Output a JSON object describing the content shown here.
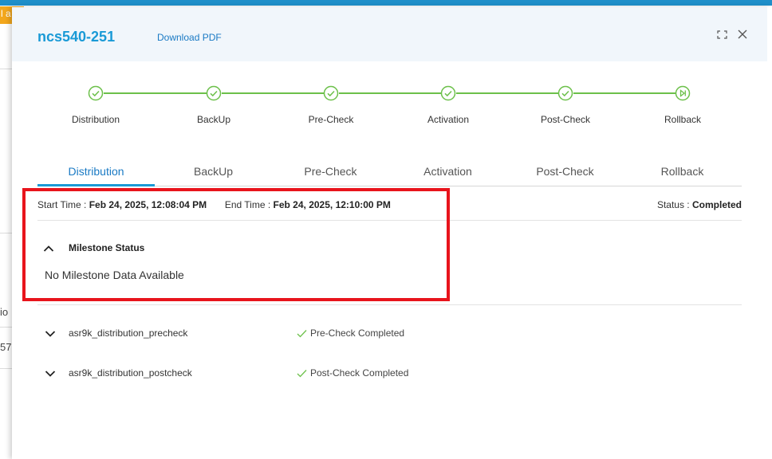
{
  "background": {
    "banner_text": "l a",
    "side_text_1": "io",
    "side_text_2": "57."
  },
  "header": {
    "title": "ncs540-251",
    "download_link": "Download PDF"
  },
  "stepper": {
    "steps": [
      {
        "label": "Distribution",
        "state": "complete",
        "icon": "check-circle-icon"
      },
      {
        "label": "BackUp",
        "state": "complete",
        "icon": "check-circle-icon"
      },
      {
        "label": "Pre-Check",
        "state": "complete",
        "icon": "check-circle-icon"
      },
      {
        "label": "Activation",
        "state": "complete",
        "icon": "check-circle-icon"
      },
      {
        "label": "Post-Check",
        "state": "complete",
        "icon": "check-circle-icon"
      },
      {
        "label": "Rollback",
        "state": "current",
        "icon": "skip-forward-circle-icon"
      }
    ],
    "accent_color": "#6cc04a"
  },
  "tabs": {
    "items": [
      "Distribution",
      "BackUp",
      "Pre-Check",
      "Activation",
      "Post-Check",
      "Rollback"
    ],
    "active": "Distribution",
    "accent_color": "#1a9ad6"
  },
  "details": {
    "start_time_label": "Start Time :",
    "start_time_value": "Feb 24, 2025, 12:08:04 PM",
    "end_time_label": "End Time :",
    "end_time_value": "Feb 24, 2025, 12:10:00 PM",
    "status_label": "Status :",
    "status_value": "Completed"
  },
  "milestone": {
    "title": "Milestone Status",
    "empty_text": "No Milestone Data Available",
    "expanded": true
  },
  "jobs": [
    {
      "name": "asr9k_distribution_precheck",
      "status": "Pre-Check Completed"
    },
    {
      "name": "asr9k_distribution_postcheck",
      "status": "Post-Check Completed"
    }
  ],
  "highlight_color": "#e8141c"
}
